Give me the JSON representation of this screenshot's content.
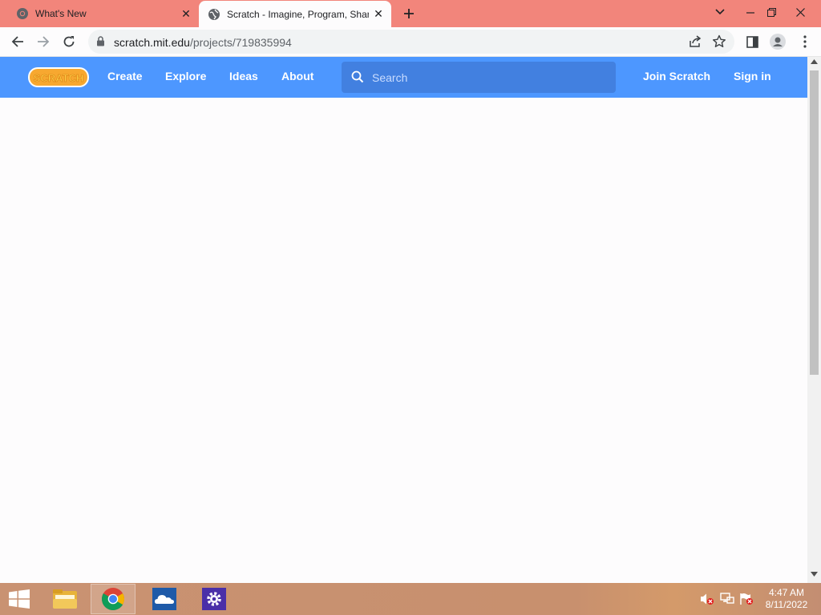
{
  "browser": {
    "tabs": [
      {
        "title": "What's New",
        "active": false,
        "favicon": "chrome-icon"
      },
      {
        "title": "Scratch - Imagine, Program, Shar",
        "active": true,
        "favicon": "globe-icon"
      }
    ],
    "address": {
      "host": "scratch.mit.edu",
      "path": "/projects/719835994"
    }
  },
  "scratch_nav": {
    "logo_text": "SCRATCH",
    "links": {
      "create": "Create",
      "explore": "Explore",
      "ideas": "Ideas",
      "about": "About"
    },
    "search_placeholder": "Search",
    "join": "Join Scratch",
    "sign_in": "Sign in"
  },
  "taskbar": {
    "clock_time": "4:47 AM",
    "clock_date": "8/11/2022"
  },
  "colors": {
    "tabstrip": "#f2857b",
    "scratch_blue": "#4d97ff",
    "search_bg": "#4280e0"
  }
}
